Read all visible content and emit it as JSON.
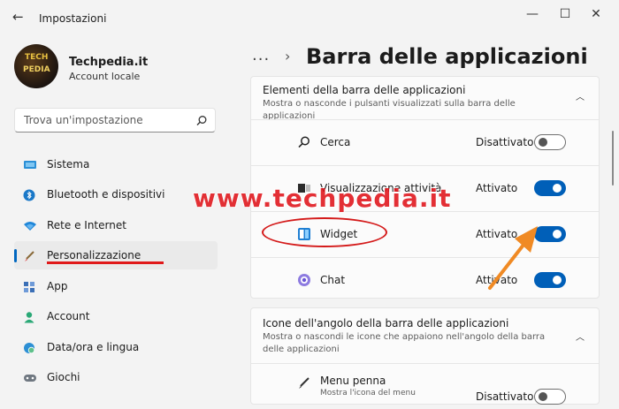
{
  "window": {
    "title": "Impostazioni"
  },
  "user": {
    "name": "Techpedia.it",
    "account_type": "Account locale"
  },
  "search": {
    "placeholder": "Trova un'impostazione"
  },
  "sidebar": {
    "items": [
      {
        "label": "Sistema",
        "icon": "monitor-icon"
      },
      {
        "label": "Bluetooth e dispositivi",
        "icon": "bluetooth-icon"
      },
      {
        "label": "Rete e Internet",
        "icon": "wifi-icon"
      },
      {
        "label": "Personalizzazione",
        "icon": "brush-icon",
        "selected": true
      },
      {
        "label": "App",
        "icon": "apps-icon"
      },
      {
        "label": "Account",
        "icon": "person-icon"
      },
      {
        "label": "Data/ora e lingua",
        "icon": "globe-clock-icon"
      },
      {
        "label": "Giochi",
        "icon": "gamepad-icon"
      }
    ]
  },
  "main": {
    "breadcrumb": "...",
    "title": "Barra delle applicazioni",
    "section1": {
      "title": "Elementi della barra delle applicazioni",
      "subtitle": "Mostra o nasconde i pulsanti visualizzati sulla barra delle applicazioni",
      "items": [
        {
          "label": "Cerca",
          "state": "Disattivato",
          "on": false,
          "icon": "search-icon"
        },
        {
          "label": "Visualizzazione attività",
          "state": "Attivato",
          "on": true,
          "icon": "task-view-icon"
        },
        {
          "label": "Widget",
          "state": "Attivato",
          "on": true,
          "icon": "widget-icon"
        },
        {
          "label": "Chat",
          "state": "Attivato",
          "on": true,
          "icon": "chat-icon"
        }
      ]
    },
    "section2": {
      "title": "Icone dell'angolo della barra delle applicazioni",
      "subtitle": "Mostra o nascondi le icone che appaiono nell'angolo della barra delle applicazioni",
      "items": [
        {
          "label": "Menu penna",
          "sublabel": "Mostra l'icona del menu",
          "state": "Disattivato",
          "on": false,
          "icon": "pen-icon"
        }
      ]
    }
  },
  "watermark": "www.techpedia.it",
  "colors": {
    "accent": "#005fb8",
    "annotation": "#d41a1a",
    "arrow": "#f08a24"
  }
}
